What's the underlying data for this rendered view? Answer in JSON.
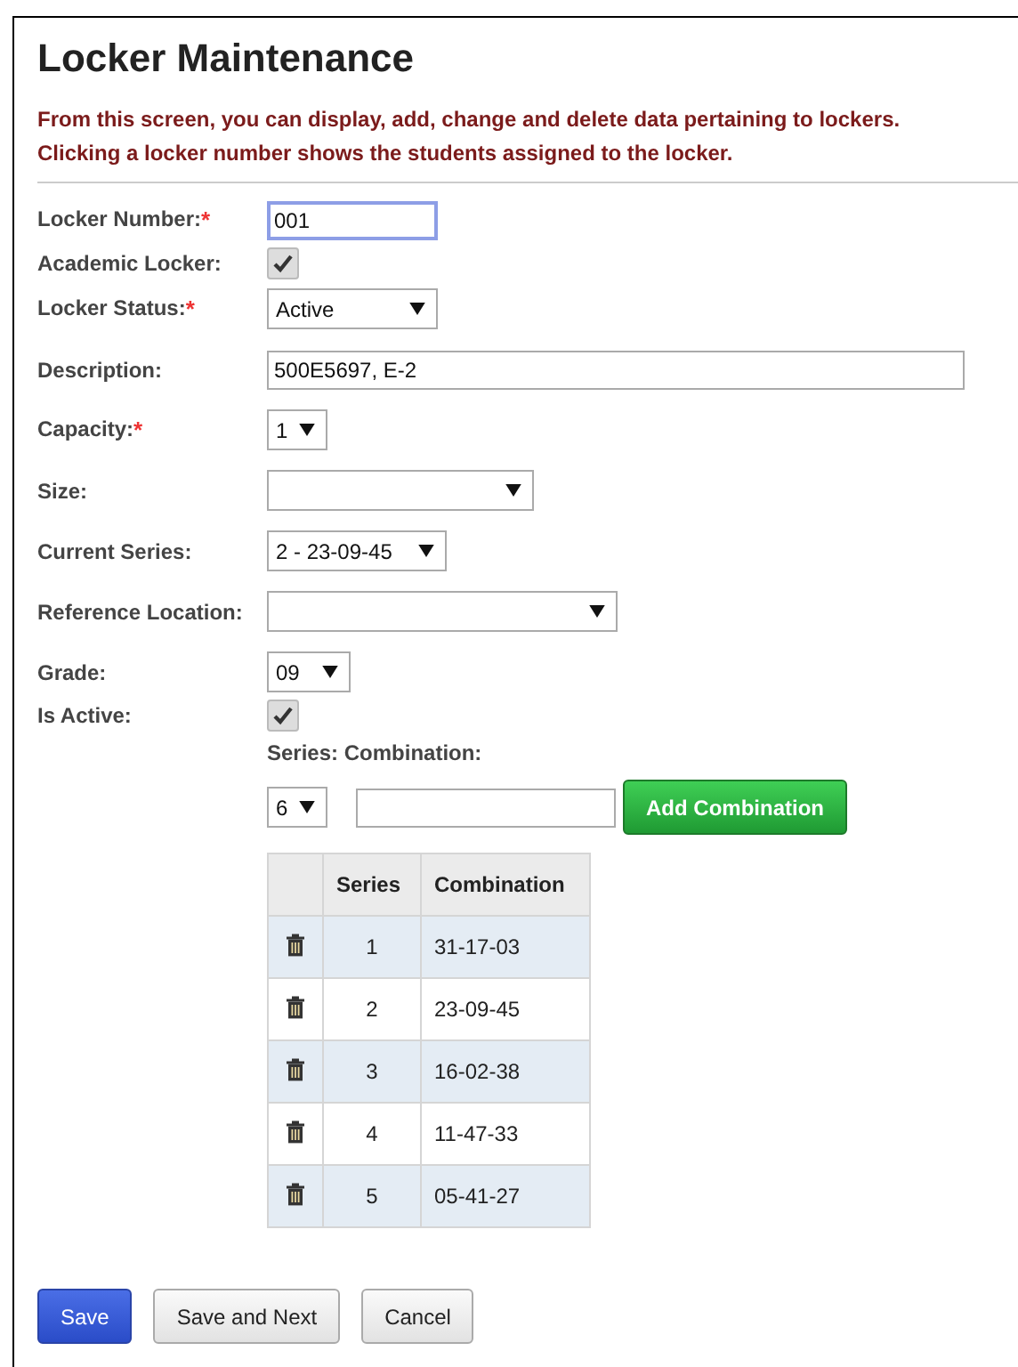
{
  "title": "Locker Maintenance",
  "intro": [
    "From this screen, you can display, add, change and delete data pertaining to lockers.",
    "Clicking a locker number shows the students assigned to the locker."
  ],
  "fields": [
    {
      "label": "Locker Number:",
      "required_mark": "*",
      "kind": "text",
      "value": "001",
      "focused": true
    },
    {
      "label": "Academic Locker:",
      "kind": "checkbox",
      "checked": true
    },
    {
      "label": "Locker Status:",
      "required_mark": "*",
      "kind": "select",
      "value": "Active"
    },
    {
      "label": "Description:",
      "kind": "text",
      "value": "500E5697, E-2",
      "focused": false
    },
    {
      "label": "Capacity:",
      "required_mark": "*",
      "kind": "select",
      "value": "1"
    },
    {
      "label": "Size:",
      "kind": "select"
    },
    {
      "label": "Current Series:",
      "kind": "select",
      "value": "2 - 23-09-45"
    },
    {
      "label": "Reference Location:",
      "kind": "select"
    },
    {
      "label": "Grade:",
      "kind": "select",
      "value": "09"
    },
    {
      "label": "Is Active:",
      "kind": "checkbox",
      "checked": true
    }
  ],
  "combination": {
    "label": "Series: Combination:",
    "series_value": "6",
    "add_button": "Add Combination"
  },
  "table": {
    "columns": [
      "Series",
      "Combination"
    ],
    "rows": [
      {
        "series": "1",
        "combination": "31-17-03"
      },
      {
        "series": "2",
        "combination": "23-09-45"
      },
      {
        "series": "3",
        "combination": "16-02-38"
      },
      {
        "series": "4",
        "combination": "11-47-33"
      },
      {
        "series": "5",
        "combination": "05-41-27"
      }
    ]
  },
  "buttons": [
    {
      "label": "Save",
      "primary": true
    },
    {
      "label": "Save and Next",
      "primary": false
    },
    {
      "label": "Cancel",
      "primary": false
    }
  ]
}
